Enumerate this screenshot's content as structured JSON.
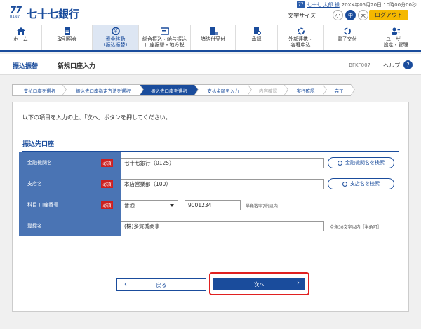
{
  "header": {
    "logo_number": "77",
    "logo_sub": "BANK",
    "bank_name": "七十七銀行",
    "user_badge": "77",
    "user_name": "七十七 太郎 様",
    "login_time": "20XX年05月20日 10時00分00秒",
    "font_size_label": "文字サイズ",
    "font_sizes": [
      "小",
      "中",
      "大"
    ],
    "font_size_selected": "中",
    "logout_label": "ログアウト"
  },
  "nav": [
    {
      "label": "ホーム",
      "icon": "home-icon"
    },
    {
      "label": "取引照会",
      "icon": "inquiry-icon"
    },
    {
      "label": "資金移動\n(振込振替)",
      "icon": "money-transfer-icon",
      "active": true
    },
    {
      "label": "総合振込・給与振込\n口座振替・地方税",
      "icon": "bulk-transfer-icon"
    },
    {
      "label": "諸納付受付",
      "icon": "payment-icon"
    },
    {
      "label": "承認",
      "icon": "approval-icon"
    },
    {
      "label": "外部連携・\n各種申込",
      "icon": "link-icon"
    },
    {
      "label": "電子交付",
      "icon": "e-delivery-icon"
    },
    {
      "label": "ユーザー\n設定・管理",
      "icon": "user-settings-icon"
    }
  ],
  "title": {
    "category": "振込振替",
    "page": "新規口座入力",
    "screen_id": "BFKF007",
    "help_label": "ヘルプ",
    "help_icon": "?"
  },
  "steps": [
    {
      "label": "支払口座を選択",
      "state": "done"
    },
    {
      "label": "振込先口座指定方法を選択",
      "state": "done"
    },
    {
      "label": "振込先口座を選択",
      "state": "current"
    },
    {
      "label": "支払金額を入力",
      "state": "todo"
    },
    {
      "label": "内容確認",
      "state": "disabled"
    },
    {
      "label": "実行確認",
      "state": "todo"
    },
    {
      "label": "完了",
      "state": "todo"
    }
  ],
  "instruction": "以下の項目を入力の上、「次へ」ボタンを押してください。",
  "section_title": "振込先口座",
  "required_label": "必須",
  "form": {
    "bank": {
      "label": "金融機関名",
      "value": "七十七銀行（0125）",
      "search_label": "金融機関名を検索"
    },
    "branch": {
      "label": "支店名",
      "value": "本店営業部（100）",
      "search_label": "支店名を検索"
    },
    "account": {
      "label": "科目 口座番号",
      "type_value": "普通",
      "number_value": "9001234",
      "hint": "半角数字7桁以内"
    },
    "payee": {
      "label": "登録名",
      "value": "(株)多賀城商事",
      "hint": "全角30文字以内［半角可］"
    }
  },
  "buttons": {
    "back_label": "戻る",
    "next_label": "次へ",
    "back_chevron": "‹",
    "next_chevron": "›"
  },
  "colors": {
    "primary": "#1a4c9c",
    "label_bg": "#4a74b4",
    "required": "#cc2020",
    "logout": "#f5b800",
    "highlight": "#e02020"
  }
}
